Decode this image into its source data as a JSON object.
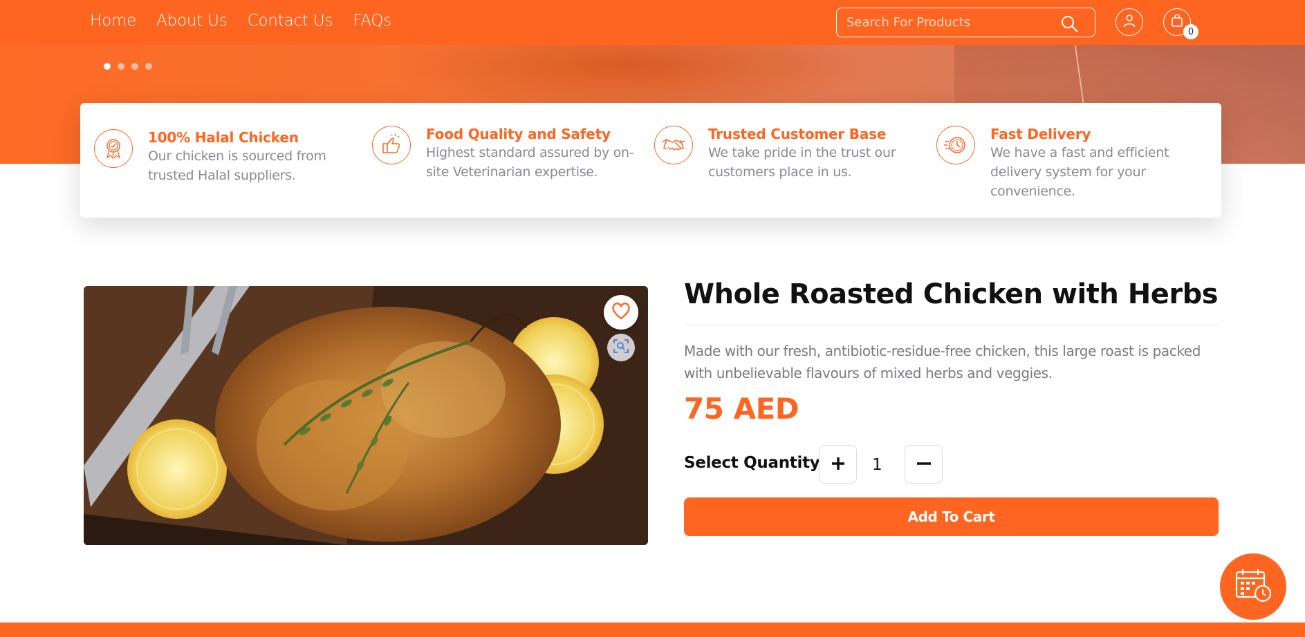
{
  "colors": {
    "brand": "#fd6520",
    "text_dark": "#111111",
    "text_muted": "#8a8a92"
  },
  "nav": {
    "items": [
      {
        "label": "Home"
      },
      {
        "label": "About Us"
      },
      {
        "label": "Contact Us"
      },
      {
        "label": "FAQs"
      }
    ]
  },
  "search": {
    "placeholder": "Search For Products",
    "icon": "search-icon"
  },
  "header_actions": {
    "user_icon": "user-icon",
    "cart_icon": "shopping-bag-icon",
    "cart_count": "0"
  },
  "hero": {
    "slide_count": 4,
    "active_slide": 1
  },
  "features": [
    {
      "icon": "halal-badge-icon",
      "title": "100% Halal Chicken",
      "desc": "Our chicken is sourced from trusted Halal suppliers."
    },
    {
      "icon": "thumbs-up-icon",
      "title": "Food Quality and Safety",
      "desc": "Highest standard assured by on-site Veterinarian expertise."
    },
    {
      "icon": "handshake-icon",
      "title": "Trusted Customer Base",
      "desc": "We take pride in the trust our customers place in us."
    },
    {
      "icon": "fast-delivery-clock-icon",
      "title": "Fast Delivery",
      "desc": "We have a fast and efficient delivery system for your convenience."
    }
  ],
  "product": {
    "title": "Whole Roasted Chicken with Herbs",
    "description": "Made with our fresh, antibiotic-residue-free chicken, this large roast is packed with unbelievable flavours of mixed herbs and veggies.",
    "price": "75 AED",
    "quantity_label": "Select Quantity",
    "quantity": "1",
    "add_to_cart": "Add To Cart",
    "image_icon": "roasted-chicken-image",
    "wishlist_icon": "heart-icon",
    "zoom_icon": "zoom-scan-icon"
  },
  "fab": {
    "icon": "calendar-clock-icon"
  }
}
